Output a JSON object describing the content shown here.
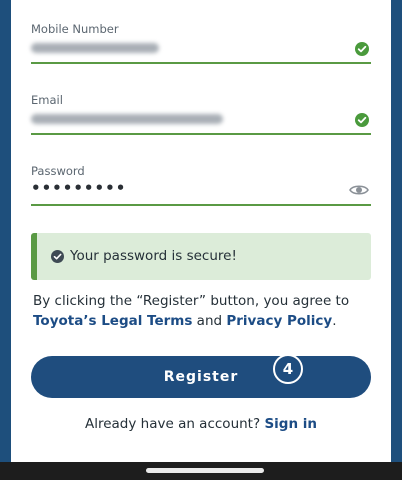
{
  "colors": {
    "accent": "#1f4d7e",
    "success": "#5a9a44",
    "banner_bg": "#dcecd9"
  },
  "form": {
    "mobile": {
      "label": "Mobile Number",
      "value_blurred": true,
      "valid_icon": "check-circle-icon"
    },
    "email": {
      "label": "Email",
      "value_blurred": true,
      "valid_icon": "check-circle-icon"
    },
    "password": {
      "label": "Password",
      "masked_value": "•••••••••",
      "toggle_icon": "eye-icon"
    }
  },
  "banner": {
    "icon": "check-circle-icon",
    "text": "Your password is secure!"
  },
  "legal": {
    "prefix": "By clicking the “Register” button, you agree to",
    "terms_link": "Toyota’s Legal Terms",
    "and": " and ",
    "privacy_link": "Privacy Policy",
    "suffix": "."
  },
  "register_button": {
    "label": "Register"
  },
  "step_badge": "4",
  "signin": {
    "prompt": "Already have an account?",
    "link": "Sign in"
  }
}
